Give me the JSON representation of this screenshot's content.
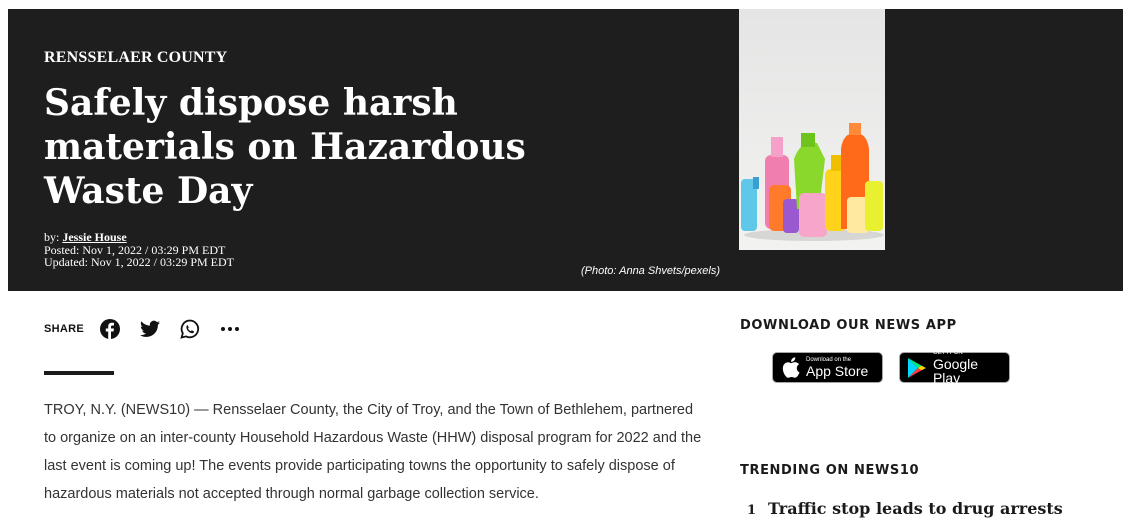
{
  "hero": {
    "section": "RENSSELAER COUNTY",
    "headline": "Safely dispose harsh materials on Hazardous Waste Day",
    "byline_prefix": "by: ",
    "author": "Jessie House",
    "posted": "Posted: Nov 1, 2022 / 03:29 PM EDT",
    "updated": "Updated: Nov 1, 2022 / 03:29 PM EDT",
    "photo_credit": "(Photo: Anna Shvets/pexels)"
  },
  "share": {
    "label": "SHARE",
    "icons": [
      "facebook-icon",
      "twitter-icon",
      "whatsapp-icon",
      "more-icon"
    ]
  },
  "article": {
    "paragraph": "TROY, N.Y. (NEWS10) — Rensselaer County, the City of Troy, and the Town of Bethlehem, partnered to organize on an inter-county Household Hazardous Waste (HHW) disposal program for 2022 and the last event is coming up! The events provide participating towns the opportunity to safely dispose of hazardous materials not accepted through normal garbage collection service."
  },
  "sidebar": {
    "app_heading": "DOWNLOAD OUR NEWS APP",
    "app_store": {
      "small": "Download on the",
      "big": "App Store"
    },
    "google_play": {
      "small": "GET IT ON",
      "big": "Google Play"
    },
    "trending_heading": "TRENDING ON NEWS10",
    "trending": [
      {
        "num": "1",
        "title": "Traffic stop leads to drug arrests"
      }
    ]
  },
  "colors": {
    "hero_bg": "#1e1e1e",
    "text": "#333333",
    "white": "#ffffff"
  }
}
